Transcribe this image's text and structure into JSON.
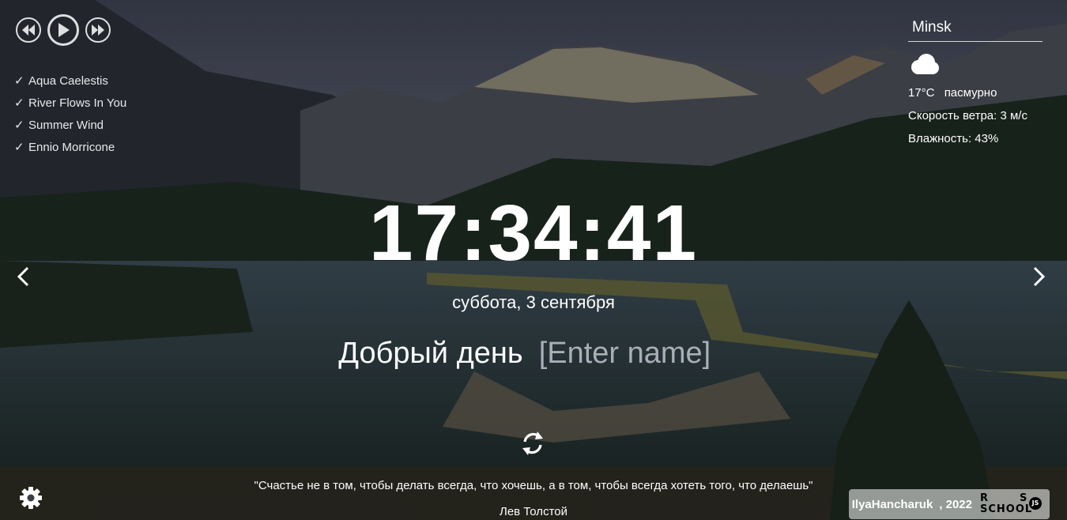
{
  "player": {
    "prev_icon": "rewind-icon",
    "play_icon": "play-icon",
    "next_icon": "fast-forward-icon",
    "playlist": [
      {
        "check": "✓",
        "title": "Aqua Caelestis"
      },
      {
        "check": "✓",
        "title": "River Flows In You"
      },
      {
        "check": "✓",
        "title": "Summer Wind"
      },
      {
        "check": "✓",
        "title": "Ennio Morricone"
      }
    ]
  },
  "weather": {
    "city": "Minsk",
    "icon": "cloud-icon",
    "temperature": "17°C",
    "description": "пасмурно",
    "wind": "Скорость ветра: 3 м/с",
    "humidity": "Влажность: 43%"
  },
  "clock": {
    "time": "17:34:41",
    "date": "суббота, 3 сентября"
  },
  "greeting": {
    "text": "Добрый день",
    "name_placeholder": "[Enter name]"
  },
  "quote": {
    "text": "\"Счастье не в том, чтобы делать всегда, что хочешь, а в том, чтобы всегда хотеть того, что делаешь\"",
    "author": "Лев Толстой"
  },
  "footer": {
    "author_link": "IlyaHancharuk",
    "year": ", 2022",
    "logo_line1": "RS",
    "logo_line2": "SCHOOL",
    "logo_badge": "JS"
  },
  "colors": {
    "text": "#ffffff",
    "placeholder": "#a9aeb8"
  }
}
